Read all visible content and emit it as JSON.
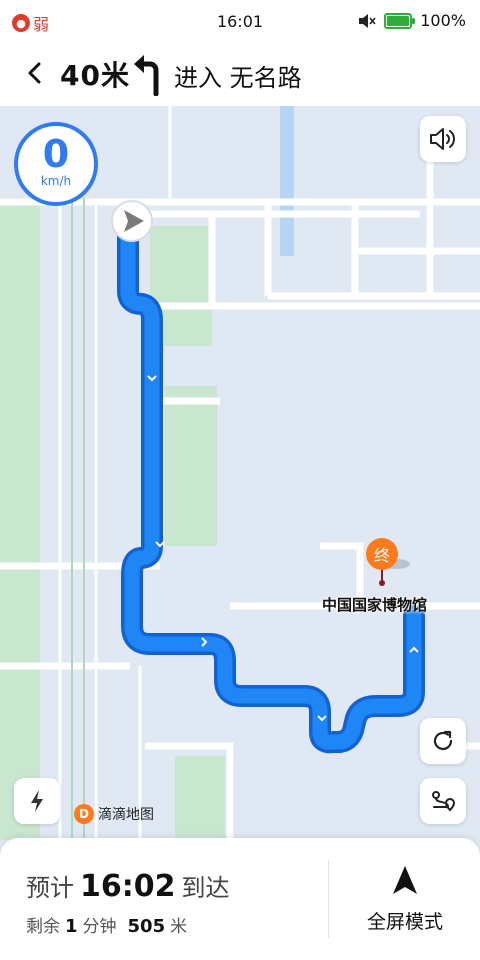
{
  "status_bar": {
    "signal_label": "弱",
    "time": "16:01",
    "battery": "100%",
    "icons": [
      "signal-weak-icon",
      "mute-icon",
      "battery-charging-icon"
    ]
  },
  "header": {
    "distance": "40米",
    "instruction": "进入 无名路",
    "turn_icon": "turn-left-arrow-icon"
  },
  "map": {
    "speed_value": "0",
    "speed_unit": "km/h",
    "destination_marker": "终",
    "destination_name": "中国国家博物馆",
    "brand": "滴滴地图",
    "colors": {
      "route": "#1f86f5",
      "route_border": "#1262d4",
      "accent": "#2f7af5",
      "marker": "#ff7a1a"
    }
  },
  "panel": {
    "eta_prefix": "预计",
    "eta_time": "16:02",
    "eta_suffix": "到达",
    "remain_prefix": "剩余",
    "remain_minutes": "1",
    "remain_min_unit": "分钟",
    "remain_distance": "505",
    "remain_dist_unit": "米",
    "fullscreen_label": "全屏模式"
  }
}
